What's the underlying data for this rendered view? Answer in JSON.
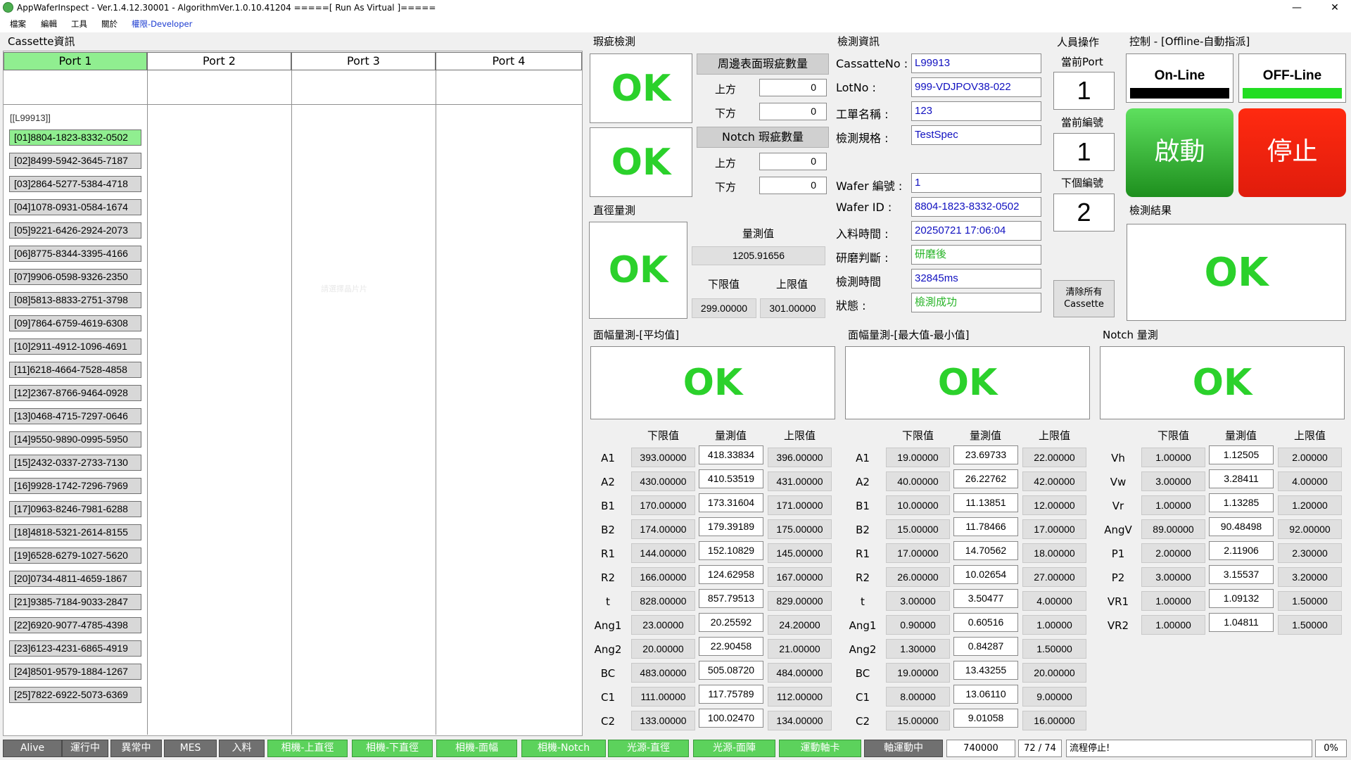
{
  "window": {
    "title": "AppWaferInspect - Ver.1.4.12.30001 - AlgorithmVer.1.0.10.41204 =====[ Run As Virtual ]=====",
    "minimize": "—",
    "close": "✕"
  },
  "menu": {
    "file": "檔案",
    "edit": "編輯",
    "tools": "工具",
    "about": "關於",
    "perm": "權限-Developer"
  },
  "cassette": {
    "title": "Cassette資訊",
    "ports": [
      "Port 1",
      "Port 2",
      "Port 3",
      "Port 4"
    ],
    "cassette_id": "[[L99913]]",
    "watermark": "請選擇晶片片",
    "wafers": [
      "[01]8804-1823-8332-0502",
      "[02]8499-5942-3645-7187",
      "[03]2864-5277-5384-4718",
      "[04]1078-0931-0584-1674",
      "[05]9221-6426-2924-2073",
      "[06]8775-8344-3395-4166",
      "[07]9906-0598-9326-2350",
      "[08]5813-8833-2751-3798",
      "[09]7864-6759-4619-6308",
      "[10]2911-4912-1096-4691",
      "[11]6218-4664-7528-4858",
      "[12]2367-8766-9464-0928",
      "[13]0468-4715-7297-0646",
      "[14]9550-9890-0995-5950",
      "[15]2432-0337-2733-7130",
      "[16]9928-1742-7296-7969",
      "[17]0963-8246-7981-6288",
      "[18]4818-5321-2614-8155",
      "[19]6528-6279-1027-5620",
      "[20]0734-4811-4659-1867",
      "[21]9385-7184-9033-2847",
      "[22]6920-9077-4785-4398",
      "[23]6123-4231-6865-4919",
      "[24]8501-9579-1884-1267",
      "[25]7822-6922-5073-6369"
    ]
  },
  "defect": {
    "title": "瑕疵檢測",
    "ok1": "OK",
    "ok2": "OK",
    "edge_title": "周邊表面瑕疵數量",
    "notch_title": "Notch 瑕疵數量",
    "up": "上方",
    "down": "下方",
    "edge_up": "0",
    "edge_down": "0",
    "notch_up": "0",
    "notch_down": "0"
  },
  "diameter": {
    "title": "直徑量測",
    "ok": "OK",
    "measured_label": "量測值",
    "measured": "1205.91656",
    "lower_label": "下限值",
    "upper_label": "上限值",
    "lower": "299.00000",
    "upper": "301.00000"
  },
  "info": {
    "title": "檢測資訊",
    "labels": {
      "cassette": "CassatteNo :",
      "lot": "LotNo :",
      "work": "工單名稱 :",
      "spec": "檢測規格 :",
      "wafer_no": "Wafer 編號 :",
      "wafer_id": "Wafer ID :",
      "load_time": "入料時間 :",
      "grind": "研磨判斷 :",
      "inspect_time": "檢測時間",
      "status": "狀態 :"
    },
    "values": {
      "cassette": "L99913",
      "lot": "999-VDJPOV38-022",
      "work": "123",
      "spec": "TestSpec",
      "wafer_no": "1",
      "wafer_id": "8804-1823-8332-0502",
      "load_time": "20250721 17:06:04",
      "grind": "研磨後",
      "inspect_time": "32845ms",
      "status": "檢測成功"
    }
  },
  "operator": {
    "title": "人員操作",
    "cur_port_label": "當前Port",
    "cur_port": "1",
    "cur_no_label": "當前編號",
    "cur_no": "1",
    "next_no_label": "下個編號",
    "next_no": "2",
    "clear": "清除所有Cassette"
  },
  "control": {
    "title": "控制 - [Offline-自動指派]",
    "online": "On-Line",
    "offline": "OFF-Line",
    "start": "啟動",
    "stop": "停止"
  },
  "result": {
    "title": "檢測結果",
    "ok": "OK"
  },
  "avg": {
    "title": "面幅量測-[平均值]",
    "ok": "OK",
    "h_low": "下限值",
    "h_meas": "量測值",
    "h_up": "上限值",
    "rows": [
      {
        "name": "A1",
        "low": "393.00000",
        "meas": "418.33834",
        "up": "396.00000"
      },
      {
        "name": "A2",
        "low": "430.00000",
        "meas": "410.53519",
        "up": "431.00000"
      },
      {
        "name": "B1",
        "low": "170.00000",
        "meas": "173.31604",
        "up": "171.00000"
      },
      {
        "name": "B2",
        "low": "174.00000",
        "meas": "179.39189",
        "up": "175.00000"
      },
      {
        "name": "R1",
        "low": "144.00000",
        "meas": "152.10829",
        "up": "145.00000"
      },
      {
        "name": "R2",
        "low": "166.00000",
        "meas": "124.62958",
        "up": "167.00000"
      },
      {
        "name": "t",
        "low": "828.00000",
        "meas": "857.79513",
        "up": "829.00000"
      },
      {
        "name": "Ang1",
        "low": "23.00000",
        "meas": "20.25592",
        "up": "24.20000"
      },
      {
        "name": "Ang2",
        "low": "20.00000",
        "meas": "22.90458",
        "up": "21.00000"
      },
      {
        "name": "BC",
        "low": "483.00000",
        "meas": "505.08720",
        "up": "484.00000"
      },
      {
        "name": "C1",
        "low": "111.00000",
        "meas": "117.75789",
        "up": "112.00000"
      },
      {
        "name": "C2",
        "low": "133.00000",
        "meas": "100.02470",
        "up": "134.00000"
      }
    ]
  },
  "maxmin": {
    "title": "面幅量測-[最大值-最小值]",
    "ok": "OK",
    "h_low": "下限值",
    "h_meas": "量測值",
    "h_up": "上限值",
    "rows": [
      {
        "name": "A1",
        "low": "19.00000",
        "meas": "23.69733",
        "up": "22.00000"
      },
      {
        "name": "A2",
        "low": "40.00000",
        "meas": "26.22762",
        "up": "42.00000"
      },
      {
        "name": "B1",
        "low": "10.00000",
        "meas": "11.13851",
        "up": "12.00000"
      },
      {
        "name": "B2",
        "low": "15.00000",
        "meas": "11.78466",
        "up": "17.00000"
      },
      {
        "name": "R1",
        "low": "17.00000",
        "meas": "14.70562",
        "up": "18.00000"
      },
      {
        "name": "R2",
        "low": "26.00000",
        "meas": "10.02654",
        "up": "27.00000"
      },
      {
        "name": "t",
        "low": "3.00000",
        "meas": "3.50477",
        "up": "4.00000"
      },
      {
        "name": "Ang1",
        "low": "0.90000",
        "meas": "0.60516",
        "up": "1.00000"
      },
      {
        "name": "Ang2",
        "low": "1.30000",
        "meas": "0.84287",
        "up": "1.50000"
      },
      {
        "name": "BC",
        "low": "19.00000",
        "meas": "13.43255",
        "up": "20.00000"
      },
      {
        "name": "C1",
        "low": "8.00000",
        "meas": "13.06110",
        "up": "9.00000"
      },
      {
        "name": "C2",
        "low": "15.00000",
        "meas": "9.01058",
        "up": "16.00000"
      }
    ]
  },
  "notch": {
    "title": "Notch 量測",
    "ok": "OK",
    "h_low": "下限值",
    "h_meas": "量測值",
    "h_up": "上限值",
    "rows": [
      {
        "name": "Vh",
        "low": "1.00000",
        "meas": "1.12505",
        "up": "2.00000"
      },
      {
        "name": "Vw",
        "low": "3.00000",
        "meas": "3.28411",
        "up": "4.00000"
      },
      {
        "name": "Vr",
        "low": "1.00000",
        "meas": "1.13285",
        "up": "1.20000"
      },
      {
        "name": "AngV",
        "low": "89.00000",
        "meas": "90.48498",
        "up": "92.00000"
      },
      {
        "name": "P1",
        "low": "2.00000",
        "meas": "2.11906",
        "up": "2.30000"
      },
      {
        "name": "P2",
        "low": "3.00000",
        "meas": "3.15537",
        "up": "3.20000"
      },
      {
        "name": "VR1",
        "low": "1.00000",
        "meas": "1.09132",
        "up": "1.50000"
      },
      {
        "name": "VR2",
        "low": "1.00000",
        "meas": "1.04811",
        "up": "1.50000"
      }
    ]
  },
  "status": {
    "buttons": [
      {
        "label": "Alive",
        "on": false
      },
      {
        "label": "運行中",
        "on": false
      },
      {
        "label": "異常中",
        "on": false
      },
      {
        "label": "MES",
        "on": false
      },
      {
        "label": "入料",
        "on": false
      },
      {
        "label": "相機-上直徑",
        "on": true
      },
      {
        "label": "相機-下直徑",
        "on": true
      },
      {
        "label": "相機-面幅",
        "on": true
      },
      {
        "label": "相機-Notch",
        "on": true
      },
      {
        "label": "光源-直徑",
        "on": true
      },
      {
        "label": "光源-面陣",
        "on": true
      },
      {
        "label": "運動軸卡",
        "on": true
      },
      {
        "label": "軸運動中",
        "on": false
      }
    ],
    "counter": "740000",
    "progress": "72 / 74",
    "message": "流程停止!",
    "percent": "0%"
  },
  "colors": {
    "ok_green": "#2bd12b",
    "port_active": "#90ee90",
    "start_green": "#2eaa2e",
    "stop_red": "#e02010",
    "offline_indicator": "#22dd22"
  }
}
